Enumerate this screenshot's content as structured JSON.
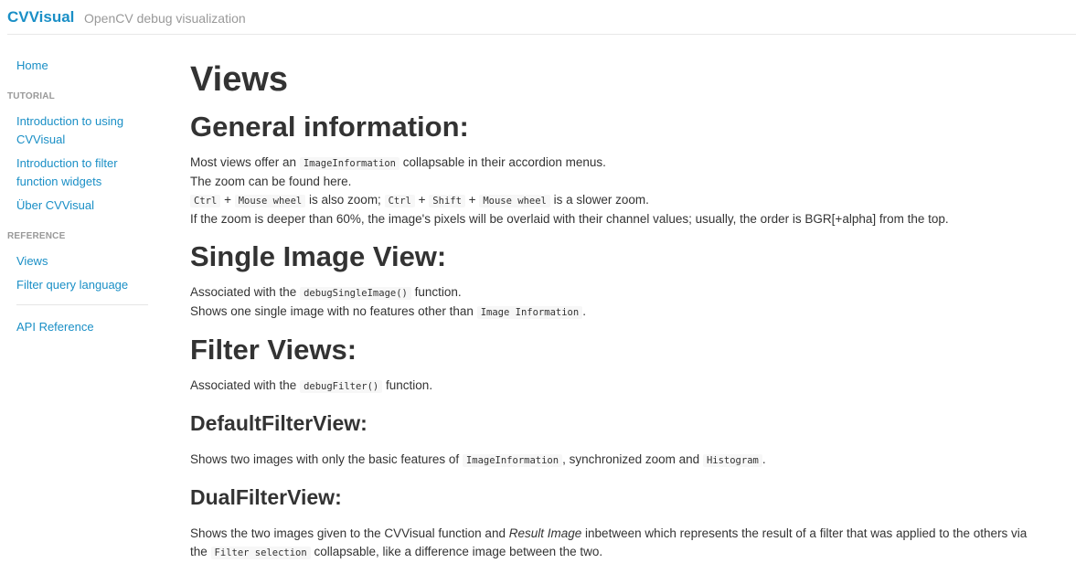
{
  "header": {
    "brand": "CVVisual",
    "tagline": "OpenCV debug visualization"
  },
  "sidebar": {
    "home": "Home",
    "tutorial_heading": "TUTORIAL",
    "tutorial_items": [
      "Introduction to using CVVisual",
      "Introduction to filter function widgets",
      "Über CVVisual"
    ],
    "reference_heading": "REFERENCE",
    "reference_items": [
      "Views",
      "Filter query language"
    ],
    "api": "API Reference"
  },
  "content": {
    "title": "Views",
    "general": {
      "heading": "General information:",
      "l1_a": "Most views offer an",
      "l1_code": "ImageInformation",
      "l1_b": "collapsable in their accordion menus.",
      "l2": "The zoom can be found here.",
      "l3_c1": "Ctrl",
      "l3_plus1": "+",
      "l3_c2": "Mouse wheel",
      "l3_mid": "is also zoom;",
      "l3_c3": "Ctrl",
      "l3_plus2": "+",
      "l3_c4": "Shift",
      "l3_plus3": "+",
      "l3_c5": "Mouse wheel",
      "l3_end": "is a slower zoom.",
      "l4": "If the zoom is deeper than 60%, the image's pixels will be overlaid with their channel values; usually, the order is BGR[+alpha] from the top."
    },
    "single": {
      "heading": "Single Image View:",
      "l1_a": "Associated with the",
      "l1_code": "debugSingleImage()",
      "l1_b": "function.",
      "l2_a": "Shows one single image with no features other than",
      "l2_code": "Image Information",
      "l2_b": "."
    },
    "filter": {
      "heading": "Filter Views:",
      "l1_a": "Associated with the",
      "l1_code": "debugFilter()",
      "l1_b": "function."
    },
    "default_filter": {
      "heading": "DefaultFilterView:",
      "l1_a": "Shows two images with only the basic features of",
      "l1_code": "ImageInformation",
      "l1_b": ", synchronized zoom and",
      "l1_code2": "Histogram",
      "l1_c": "."
    },
    "dual_filter": {
      "heading": "DualFilterView:",
      "l1_a": "Shows the two images given to the CVVisual function and",
      "l1_em": "Result Image",
      "l1_b": "inbetween which represents the result of a filter that was applied to the others via",
      "l2_a": "the",
      "l2_code": "Filter selection",
      "l2_b": "collapsable, like a difference image between the two."
    }
  }
}
